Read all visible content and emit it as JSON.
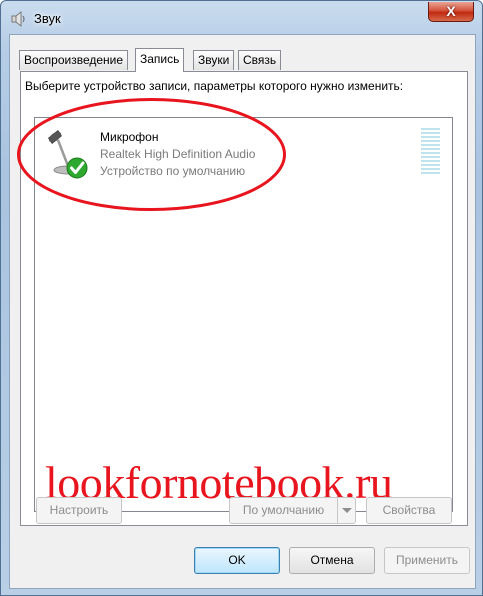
{
  "window": {
    "title": "Звук",
    "close_label": "X"
  },
  "tabs": [
    {
      "label": "Воспроизведение",
      "active": false
    },
    {
      "label": "Запись",
      "active": true
    },
    {
      "label": "Звуки",
      "active": false
    },
    {
      "label": "Связь",
      "active": false
    }
  ],
  "recording": {
    "instruction": "Выберите устройство записи, параметры которого нужно изменить:",
    "devices": [
      {
        "name": "Микрофон",
        "driver": "Realtek High Definition Audio",
        "status": "Устройство по умолчанию",
        "icon": "microphone-icon",
        "badge": "default-check-icon"
      }
    ],
    "buttons": {
      "configure": "Настроить",
      "set_default": "По умолчанию",
      "properties": "Свойства"
    }
  },
  "watermark": "lookfornotebook.ru",
  "dialog_buttons": {
    "ok": "OK",
    "cancel": "Отмена",
    "apply": "Применить"
  },
  "colors": {
    "annotation": "#e8141e",
    "level_meter": "#bfe3ec",
    "check": "#2fa82f"
  }
}
